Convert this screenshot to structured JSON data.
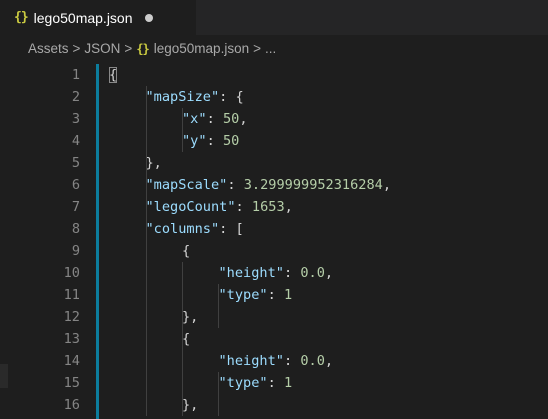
{
  "tab": {
    "icon": "{}",
    "label": "lego50map.json"
  },
  "breadcrumb": {
    "items": [
      "Assets",
      "JSON"
    ],
    "file_icon": "{}",
    "file_label": "lego50map.json",
    "ellipsis": "...",
    "separator": ">"
  },
  "editor": {
    "lines": [
      {
        "n": "1"
      },
      {
        "n": "2",
        "key": "\"mapSize\"",
        "after": ": {"
      },
      {
        "n": "3",
        "key": "\"x\"",
        "mid": ": ",
        "num": "50",
        "after": ","
      },
      {
        "n": "4",
        "key": "\"y\"",
        "mid": ": ",
        "num": "50"
      },
      {
        "n": "5",
        "text": "},"
      },
      {
        "n": "6",
        "key": "\"mapScale\"",
        "mid": ": ",
        "num": "3.299999952316284",
        "after": ","
      },
      {
        "n": "7",
        "key": "\"legoCount\"",
        "mid": ": ",
        "num": "1653",
        "after": ","
      },
      {
        "n": "8",
        "key": "\"columns\"",
        "after": ": ["
      },
      {
        "n": "9",
        "text": "{"
      },
      {
        "n": "10",
        "key": "\"height\"",
        "mid": ": ",
        "num": "0.0",
        "after": ","
      },
      {
        "n": "11",
        "key": "\"type\"",
        "mid": ": ",
        "num": "1"
      },
      {
        "n": "12",
        "text": "},"
      },
      {
        "n": "13",
        "text": "{"
      },
      {
        "n": "14",
        "key": "\"height\"",
        "mid": ": ",
        "num": "0.0",
        "after": ","
      },
      {
        "n": "15",
        "key": "\"type\"",
        "mid": ": ",
        "num": "1"
      },
      {
        "n": "16",
        "text": "},"
      }
    ],
    "first_line_brace": "{"
  },
  "colors": {
    "background": "#1e1e1e",
    "key": "#9cdcfe",
    "number": "#b5cea8",
    "line_number": "#858585",
    "json_icon": "#cbcb41",
    "gutter_bar": "#0c7d9d"
  },
  "icons": {
    "tab": "json-file-icon",
    "breadcrumb": "json-file-icon",
    "dirty": "unsaved-dot-icon"
  }
}
